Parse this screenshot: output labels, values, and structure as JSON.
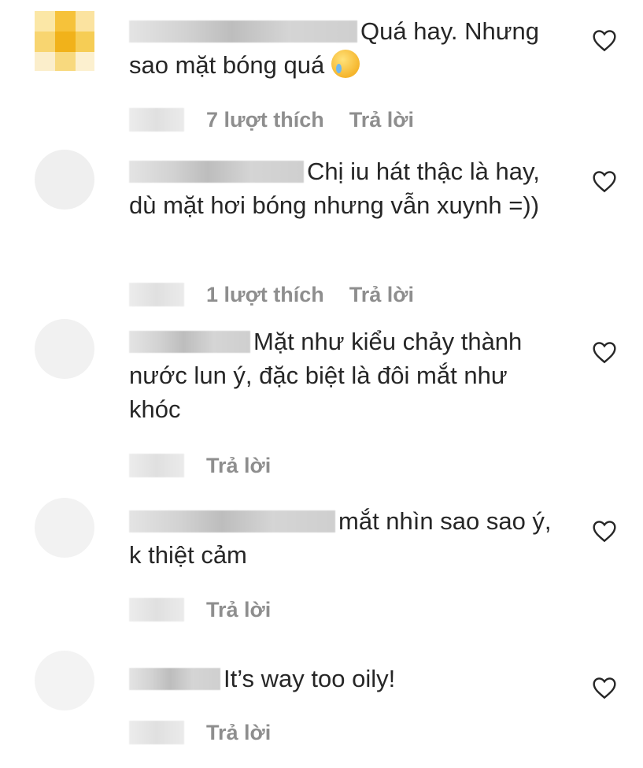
{
  "comments": [
    {
      "text": "Quá hay. Nhưng sao mặt bóng quá",
      "emoji": "crying-face-emoji",
      "likes": "7 lượt thích",
      "reply": "Trả lời"
    },
    {
      "text": "Chị iu hát thậc là hay, dù mặt hơi bóng nhưng vẫn xuynh =))",
      "likes": "1 lượt thích",
      "reply": "Trả lời"
    },
    {
      "text": "Mặt như kiểu chảy thành nước lun ý, đặc biệt là đôi mắt như khóc",
      "reply": "Trả lời"
    },
    {
      "text": "mắt nhìn sao sao ý, k thiệt cảm",
      "reply": "Trả lời"
    },
    {
      "text": "It’s way too oily!",
      "reply": "Trả lời"
    }
  ],
  "colors": {
    "text": "#262626",
    "meta": "#8e8e8e",
    "background": "#ffffff"
  },
  "icons": {
    "like": "heart-outline-icon"
  }
}
